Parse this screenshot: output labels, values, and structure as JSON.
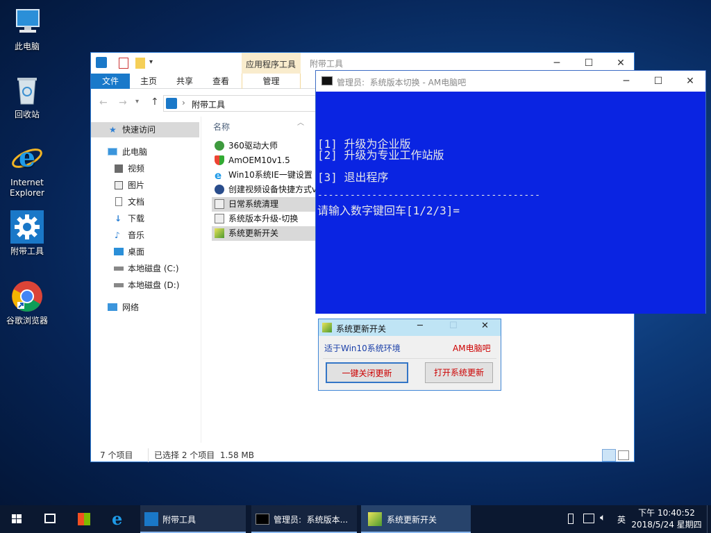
{
  "desktop": {
    "icons": [
      {
        "label": "此电脑"
      },
      {
        "label": "回收站"
      },
      {
        "label": "Internet\nExplorer"
      },
      {
        "label": "附带工具"
      },
      {
        "label": "谷歌浏览器"
      }
    ]
  },
  "explorer": {
    "title": "附带工具",
    "context_tab_group": "应用程序工具",
    "tabs": [
      "文件",
      "主页",
      "共享",
      "查看",
      "管理"
    ],
    "address": "附带工具",
    "nav": {
      "quick_access": "快速访问",
      "this_pc": "此电脑",
      "items": [
        "视频",
        "图片",
        "文档",
        "下载",
        "音乐",
        "桌面",
        "本地磁盘 (C:)",
        "本地磁盘 (D:)"
      ],
      "network": "网络"
    },
    "column_header": "名称",
    "files": [
      {
        "name": "360驱动大师",
        "selected": false
      },
      {
        "name": "AmOEM10v1.5",
        "selected": false
      },
      {
        "name": "Win10系统IE一键设置",
        "selected": false
      },
      {
        "name": "创建视频设备快捷方式v",
        "selected": false
      },
      {
        "name": "日常系统清理",
        "selected": true
      },
      {
        "name": "系统版本升级-切换",
        "selected": false
      },
      {
        "name": "系统更新开关",
        "selected": true
      }
    ],
    "status": {
      "count": "7 个项目",
      "selected": "已选择 2 个项目  1.58 MB"
    }
  },
  "cmd": {
    "title": "管理员:  系统版本切换 - AM电脑吧",
    "lines": [
      "[1] 升级为企业版",
      "[2] 升级为专业工作站版",
      "[3] 退出程序",
      "-----------------------------------------",
      "请输入数字键回车[1/2/3]="
    ]
  },
  "dialog": {
    "title": "系统更新开关",
    "env_text": "适于Win10系统环境",
    "brand": "AM电脑吧",
    "btn_close": "一键关闭更新",
    "btn_open": "打开系统更新"
  },
  "taskbar": {
    "items": [
      "附带工具",
      "管理员:  系统版本...",
      "系统更新开关"
    ],
    "ime": "英",
    "time": "下午 10:40:52",
    "date": "2018/5/24 星期四"
  },
  "colors": {
    "cmd_bg": "#0a24e2",
    "accent": "#1979ca",
    "button_text": "#cc0000"
  }
}
